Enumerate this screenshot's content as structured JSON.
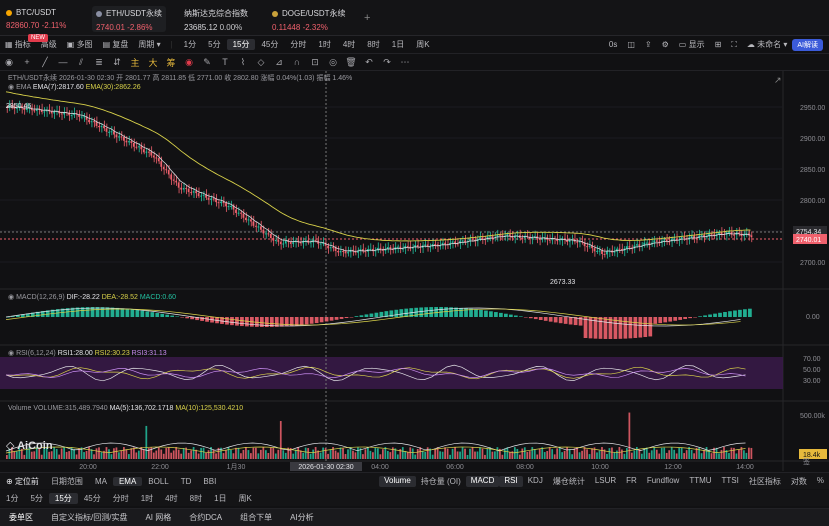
{
  "tickers": [
    {
      "name": "BTC/USDT",
      "price": "82860.70",
      "change": "-2.11%",
      "dot": "#f7a600",
      "down": true,
      "selected": false
    },
    {
      "name": "ETH/USDT永续",
      "price": "2740.01",
      "change": "-2.86%",
      "dot": "#8a8fa3",
      "down": true,
      "selected": true
    },
    {
      "name": "纳斯达克综合指数",
      "price": "23685.12",
      "change": "0.00%",
      "dot": "",
      "down": false,
      "selected": false
    },
    {
      "name": "DOGE/USDT永续",
      "price": "0.11448",
      "change": "-2.32%",
      "dot": "#c9a13a",
      "down": true,
      "selected": false
    }
  ],
  "add_tab": "+",
  "toolbar": {
    "new_badge": "NEW",
    "items": [
      "指标",
      "高级",
      "多图",
      "复盘",
      "周期"
    ],
    "intervals": [
      "1分",
      "5分",
      "15分",
      "45分",
      "分时",
      "1时",
      "4时",
      "8时",
      "1日",
      "周K"
    ],
    "active_interval": "15分",
    "right": {
      "countdown": "0s",
      "display": "显示",
      "login": "未命名",
      "ai": "AI解读"
    }
  },
  "chart": {
    "title": "ETH/USDT永续 2026-01-30 02:30",
    "ohlc": "开 2801.77 高 2811.85 低 2771.00 收 2802.80 涨幅 0.04%(1.03) 振幅 1.46%",
    "ema_legend": {
      "name": "EMA",
      "ema7": "EMA(7):2817.60",
      "ema30": "EMA(30):2862.26"
    },
    "macd_legend": {
      "name": "MACD(12,26,9)",
      "dif": "DIF:-28.22",
      "dea": "DEA:-28.52",
      "macd": "MACD:0.60"
    },
    "rsi_legend": {
      "name": "RSI(6,12,24)",
      "rsi1": "RSI1:28.00",
      "rsi2": "RSI2:30.23",
      "rsi3": "RSI3:31.13"
    },
    "vol_legend": {
      "name": "Volume",
      "vol": "VOLUME:315,489.7940",
      "ma5": "MA(5):136,702.1718",
      "ma10": "MA(10):125,530.4210"
    },
    "price_axis": [
      "2950.00",
      "2900.00",
      "2850.00",
      "2800.00",
      "2750.00",
      "2700.00"
    ],
    "price_tag_current": "2740.01",
    "price_tag_cross": "2754.34",
    "max_label": "2950.46",
    "min_label": "2673.33",
    "macd_axis": "0.00",
    "rsi_axis": [
      "70.00",
      "50.00",
      "30.00"
    ],
    "vol_axis": "500.00k",
    "vol_tag": "18.4k",
    "time_axis": [
      "20:00",
      "22:00",
      "1月30",
      "2026-01-30 02:30",
      "04:00",
      "06:00",
      "08:00",
      "10:00",
      "12:00",
      "14:00"
    ],
    "watermark": "AiCoin",
    "corner": "签",
    "colors": {
      "up": "#23c0a0",
      "down": "#f0616d",
      "ema7": "#d8d8dc",
      "ema30": "#d9d24a"
    }
  },
  "footer_indicators": {
    "left": [
      "日期范围",
      "MA",
      "EMA",
      "BOLL",
      "TD",
      "BBI"
    ],
    "setting": "定位前",
    "right": [
      "Volume",
      "持仓量 (OI)",
      "MACD",
      "RSI",
      "KDJ",
      "爆仓统计",
      "LSUR",
      "FR",
      "Fundflow",
      "TTMU",
      "TTSI",
      "社区指标",
      "对数",
      "%"
    ],
    "active_left": "EMA",
    "active_right": [
      "Volume",
      "MACD",
      "RSI"
    ]
  },
  "footer_tf": [
    "1分",
    "5分",
    "15分",
    "45分",
    "分时",
    "1时",
    "4时",
    "8时",
    "1日",
    "周K"
  ],
  "bottom_tabs": [
    "委单区",
    "自定义指标/回测/实盘",
    "AI 网格",
    "合约DCA",
    "组合下单",
    "AI分析"
  ]
}
